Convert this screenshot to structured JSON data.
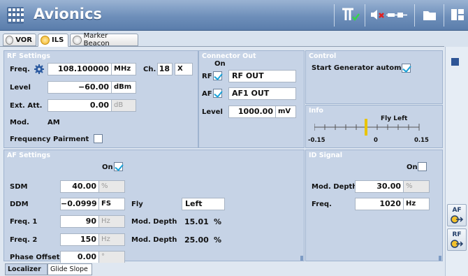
{
  "app": {
    "title": "Avionics"
  },
  "tabs": [
    {
      "label": "VOR",
      "selected": false
    },
    {
      "label": "ILS",
      "selected": true
    },
    {
      "label": "Marker Beacon",
      "selected": false
    }
  ],
  "rf_settings": {
    "title": "RF Settings",
    "freq_label": "Freq.",
    "freq_value": "108.100000",
    "freq_unit": "MHz",
    "ch_label": "Ch.",
    "ch_value": "18",
    "ch_suffix": "X",
    "level_label": "Level",
    "level_value": "−60.00",
    "level_unit": "dBm",
    "ext_att_label": "Ext. Att.",
    "ext_att_value": "0.00",
    "ext_att_unit": "dB",
    "mod_label": "Mod.",
    "mod_value": "AM",
    "freq_pairment_label": "Frequency Pairment",
    "freq_pairment_checked": false
  },
  "connector_out": {
    "title": "Connector Out",
    "on_label": "On",
    "rf_label": "RF",
    "rf_checked": true,
    "rf_value": "RF OUT",
    "af_label": "AF",
    "af_checked": true,
    "af_value": "AF1 OUT",
    "level_label": "Level",
    "level_value": "1000.00",
    "level_unit": "mV"
  },
  "control": {
    "title": "Control",
    "start_gen_label": "Start Generator autom.",
    "start_gen_checked": true
  },
  "info": {
    "title": "Info",
    "indicator_label": "Fly Left",
    "scale_left": "-0.15",
    "scale_mid": "0",
    "scale_right": "0.15"
  },
  "af_settings": {
    "title": "AF Settings",
    "on_label": "On",
    "on_checked": true,
    "sdm_label": "SDM",
    "sdm_value": "40.00",
    "sdm_unit": "%",
    "ddm_label": "DDM",
    "ddm_value": "−0.0999",
    "ddm_unit": "FS",
    "fly_label": "Fly",
    "fly_value": "Left",
    "freq1_label": "Freq. 1",
    "freq1_value": "90",
    "freq1_unit": "Hz",
    "mod_depth1_label": "Mod. Depth",
    "mod_depth1_value": "15.01",
    "mod_depth1_unit": "%",
    "freq2_label": "Freq. 2",
    "freq2_value": "150",
    "freq2_unit": "Hz",
    "mod_depth2_label": "Mod. Depth",
    "mod_depth2_value": "25.00",
    "mod_depth2_unit": "%",
    "phase_offset_label": "Phase Offset",
    "phase_offset_value": "0.00",
    "phase_offset_unit": "°"
  },
  "id_signal": {
    "title": "ID Signal",
    "on_label": "On",
    "on_checked": false,
    "mod_depth_label": "Mod. Depth",
    "mod_depth_value": "30.00",
    "mod_depth_unit": "%",
    "freq_label": "Freq.",
    "freq_value": "1020",
    "freq_unit": "Hz"
  },
  "side_buttons": [
    {
      "label": "AF"
    },
    {
      "label": "RF"
    }
  ],
  "bottom_tabs": [
    {
      "label": "Localizer",
      "selected": true
    },
    {
      "label": "Glide Slope",
      "selected": false
    }
  ],
  "colors": {
    "titlebar": "#6e8fba",
    "panel_bg": "#c6d3e6",
    "panel_title": "#8fa8ca",
    "check_accent": "#1ba3d9",
    "indicator": "#e8c400"
  }
}
